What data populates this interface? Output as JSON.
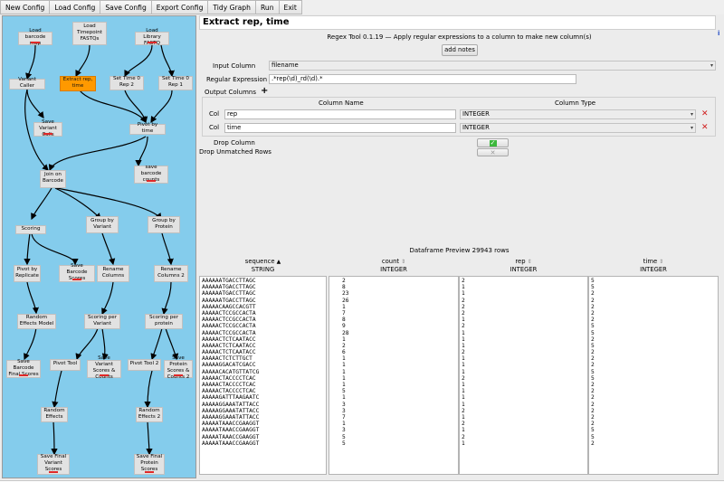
{
  "menu": [
    "New Config",
    "Load Config",
    "Save Config",
    "Export Config",
    "Tidy Graph",
    "Run",
    "Exit"
  ],
  "nodes": [
    {
      "id": "n1",
      "label": "Load barcode map",
      "bar": true,
      "sel": false
    },
    {
      "id": "n2",
      "label": "Load Timepoint FASTQs",
      "bar": false,
      "sel": false
    },
    {
      "id": "n3",
      "label": "Load Library FASTQ",
      "bar": true,
      "sel": false
    },
    {
      "id": "n4",
      "label": "Variant Caller",
      "bar": false,
      "sel": false
    },
    {
      "id": "n5",
      "label": "Extract rep, time",
      "bar": false,
      "sel": true
    },
    {
      "id": "n6",
      "label": "Set Time 0 Rep 2",
      "bar": false,
      "sel": false
    },
    {
      "id": "n7",
      "label": "Set Time 0 Rep 1",
      "bar": false,
      "sel": false
    },
    {
      "id": "n8",
      "label": "Save Variant Calls",
      "bar": true,
      "sel": false
    },
    {
      "id": "n9",
      "label": "Pivot by time",
      "bar": false,
      "sel": false
    },
    {
      "id": "n10",
      "label": "Join on Barcode",
      "bar": false,
      "sel": false
    },
    {
      "id": "n11",
      "label": "save barcode counts",
      "bar": true,
      "sel": false
    },
    {
      "id": "n12",
      "label": "Scoring",
      "bar": false,
      "sel": false
    },
    {
      "id": "n13",
      "label": "Group by Variant",
      "bar": false,
      "sel": false
    },
    {
      "id": "n14",
      "label": "Group by Protein",
      "bar": false,
      "sel": false
    },
    {
      "id": "n15",
      "label": "Pivot by Replicate",
      "bar": false,
      "sel": false
    },
    {
      "id": "n16",
      "label": "Save Barcode Scores",
      "bar": true,
      "sel": false
    },
    {
      "id": "n17",
      "label": "Rename Columns",
      "bar": false,
      "sel": false
    },
    {
      "id": "n18",
      "label": "Rename Columns 2",
      "bar": false,
      "sel": false
    },
    {
      "id": "n19",
      "label": "Random Effects Model",
      "bar": false,
      "sel": false
    },
    {
      "id": "n20",
      "label": "Scoring per Variant",
      "bar": false,
      "sel": false
    },
    {
      "id": "n21",
      "label": "Scoring per protein",
      "bar": false,
      "sel": false
    },
    {
      "id": "n22",
      "label": "Save Barcode Final Scores",
      "bar": true,
      "sel": false
    },
    {
      "id": "n23",
      "label": "Pivot Tool",
      "bar": false,
      "sel": false
    },
    {
      "id": "n24",
      "label": "Save Variant Scores & Counts",
      "bar": true,
      "sel": false
    },
    {
      "id": "n25",
      "label": "Pivot Tool 2",
      "bar": false,
      "sel": false
    },
    {
      "id": "n26",
      "label": "Save Protein Scores & Counts 2",
      "bar": true,
      "sel": false
    },
    {
      "id": "n27",
      "label": "Random Effects",
      "bar": false,
      "sel": false
    },
    {
      "id": "n28",
      "label": "Random Effects 2",
      "bar": false,
      "sel": false
    },
    {
      "id": "n29",
      "label": "Save Final Variant Scores",
      "bar": true,
      "sel": false
    },
    {
      "id": "n30",
      "label": "Save Final Protein Scores",
      "bar": true,
      "sel": false
    }
  ],
  "panel": {
    "title": "Extract rep, time",
    "subtitle": "Regex Tool 0.1.19 — Apply regular expressions to a column to make new column(s)",
    "add_notes": "add notes",
    "input_column_label": "Input Column",
    "input_column_value": "filename",
    "regex_label": "Regular Expression",
    "regex_value": ".*rep(\\d)_rd(\\d).*",
    "output_columns_label": "Output Columns",
    "add_icon": "+",
    "col_name_header": "Column Name",
    "col_type_header": "Column Type",
    "col_label": "Col",
    "output_columns": [
      {
        "name": "rep",
        "type": "INTEGER"
      },
      {
        "name": "time",
        "type": "INTEGER"
      }
    ],
    "drop_column_label": "Drop Column",
    "drop_unmatched_label": "Drop Unmatched Rows",
    "info_icon": "i"
  },
  "preview": {
    "title": "Dataframe Preview 29943 rows",
    "columns": [
      {
        "name": "sequence",
        "type": "STRING",
        "sorted": true
      },
      {
        "name": "count",
        "type": "INTEGER",
        "sorted": false
      },
      {
        "name": "rep",
        "type": "INTEGER",
        "sorted": false
      },
      {
        "name": "time",
        "type": "INTEGER",
        "sorted": false
      }
    ],
    "rows": [
      [
        "AAAAAATGACCTTAGC",
        "2",
        "2",
        "5"
      ],
      [
        "AAAAAATGACCTTAGC",
        "8",
        "1",
        "5"
      ],
      [
        "AAAAAATGACCTTAGC",
        "23",
        "1",
        "2"
      ],
      [
        "AAAAAATGACCTTAGC",
        "26",
        "2",
        "2"
      ],
      [
        "AAAAACAAGCCACGTT",
        "1",
        "2",
        "2"
      ],
      [
        "AAAAACTCCGCCACTA",
        "7",
        "2",
        "2"
      ],
      [
        "AAAAACTCCGCCACTA",
        "8",
        "1",
        "2"
      ],
      [
        "AAAAACTCCGCCACTA",
        "9",
        "2",
        "5"
      ],
      [
        "AAAAACTCCGCCACTA",
        "28",
        "1",
        "5"
      ],
      [
        "AAAAACTCTCAATACC",
        "1",
        "1",
        "2"
      ],
      [
        "AAAAACTCTCAATACC",
        "2",
        "1",
        "5"
      ],
      [
        "AAAAACTCTCAATACC",
        "6",
        "2",
        "2"
      ],
      [
        "AAAAACTCTCTTGCT",
        "1",
        "1",
        "2"
      ],
      [
        "AAAAAGGACATCGACC",
        "1",
        "1",
        "2"
      ],
      [
        "AAAAACACATGTTATCG",
        "1",
        "1",
        "5"
      ],
      [
        "AAAAACTACCCCTCAC",
        "1",
        "2",
        "5"
      ],
      [
        "AAAAACTACCCCTCAC",
        "1",
        "1",
        "2"
      ],
      [
        "AAAAACTACCCCTCAC",
        "5",
        "1",
        "2"
      ],
      [
        "AAAAAGATTTAAGAATC",
        "1",
        "1",
        "2"
      ],
      [
        "AAAAAGGAAATATTACC",
        "3",
        "1",
        "2"
      ],
      [
        "AAAAAGGAAATATTACC",
        "3",
        "2",
        "2"
      ],
      [
        "AAAAAGGAAATATTACC",
        "7",
        "1",
        "2"
      ],
      [
        "AAAAATAAACCGAAGGT",
        "1",
        "2",
        "2"
      ],
      [
        "AAAAATAAACCGAAGGT",
        "3",
        "1",
        "5"
      ],
      [
        "AAAAATAAACCGAAGGT",
        "5",
        "2",
        "5"
      ],
      [
        "AAAAATAAACCGAAGGT",
        "5",
        "1",
        "2"
      ]
    ]
  }
}
